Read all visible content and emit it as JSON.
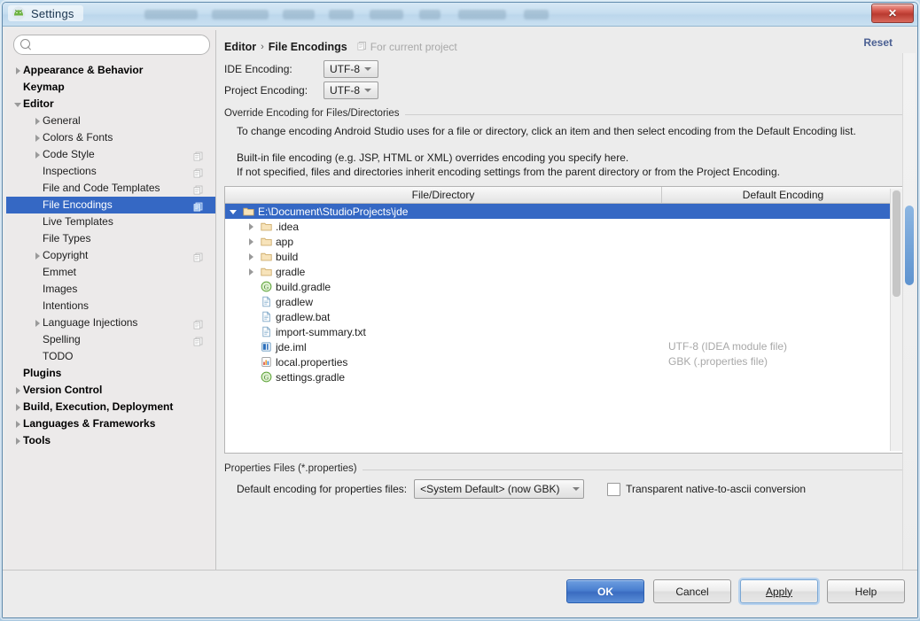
{
  "window": {
    "title": "Settings",
    "app_icon": "android-studio-icon",
    "close_label": "✕"
  },
  "sidebar": {
    "search": {
      "value": "",
      "placeholder": ""
    },
    "items": [
      {
        "label": "Appearance & Behavior",
        "level": 0,
        "bold": true,
        "arrow": "closed",
        "selected": false,
        "module_icon": false
      },
      {
        "label": "Keymap",
        "level": 0,
        "bold": true,
        "arrow": "none",
        "selected": false,
        "module_icon": false
      },
      {
        "label": "Editor",
        "level": 0,
        "bold": true,
        "arrow": "open",
        "selected": false,
        "module_icon": false
      },
      {
        "label": "General",
        "level": 1,
        "bold": false,
        "arrow": "closed",
        "selected": false,
        "module_icon": false
      },
      {
        "label": "Colors & Fonts",
        "level": 1,
        "bold": false,
        "arrow": "closed",
        "selected": false,
        "module_icon": false
      },
      {
        "label": "Code Style",
        "level": 1,
        "bold": false,
        "arrow": "closed",
        "selected": false,
        "module_icon": true
      },
      {
        "label": "Inspections",
        "level": 1,
        "bold": false,
        "arrow": "none",
        "selected": false,
        "module_icon": true
      },
      {
        "label": "File and Code Templates",
        "level": 1,
        "bold": false,
        "arrow": "none",
        "selected": false,
        "module_icon": true
      },
      {
        "label": "File Encodings",
        "level": 1,
        "bold": false,
        "arrow": "none",
        "selected": true,
        "module_icon": true
      },
      {
        "label": "Live Templates",
        "level": 1,
        "bold": false,
        "arrow": "none",
        "selected": false,
        "module_icon": false
      },
      {
        "label": "File Types",
        "level": 1,
        "bold": false,
        "arrow": "none",
        "selected": false,
        "module_icon": false
      },
      {
        "label": "Copyright",
        "level": 1,
        "bold": false,
        "arrow": "closed",
        "selected": false,
        "module_icon": true
      },
      {
        "label": "Emmet",
        "level": 1,
        "bold": false,
        "arrow": "none",
        "selected": false,
        "module_icon": false
      },
      {
        "label": "Images",
        "level": 1,
        "bold": false,
        "arrow": "none",
        "selected": false,
        "module_icon": false
      },
      {
        "label": "Intentions",
        "level": 1,
        "bold": false,
        "arrow": "none",
        "selected": false,
        "module_icon": false
      },
      {
        "label": "Language Injections",
        "level": 1,
        "bold": false,
        "arrow": "closed",
        "selected": false,
        "module_icon": true
      },
      {
        "label": "Spelling",
        "level": 1,
        "bold": false,
        "arrow": "none",
        "selected": false,
        "module_icon": true
      },
      {
        "label": "TODO",
        "level": 1,
        "bold": false,
        "arrow": "none",
        "selected": false,
        "module_icon": false
      },
      {
        "label": "Plugins",
        "level": 0,
        "bold": true,
        "arrow": "none",
        "selected": false,
        "module_icon": false
      },
      {
        "label": "Version Control",
        "level": 0,
        "bold": true,
        "arrow": "closed",
        "selected": false,
        "module_icon": false
      },
      {
        "label": "Build, Execution, Deployment",
        "level": 0,
        "bold": true,
        "arrow": "closed",
        "selected": false,
        "module_icon": false
      },
      {
        "label": "Languages & Frameworks",
        "level": 0,
        "bold": true,
        "arrow": "closed",
        "selected": false,
        "module_icon": false
      },
      {
        "label": "Tools",
        "level": 0,
        "bold": true,
        "arrow": "closed",
        "selected": false,
        "module_icon": false
      }
    ]
  },
  "main": {
    "breadcrumb": {
      "parent": "Editor",
      "separator": "›",
      "current": "File Encodings",
      "note": "For current project",
      "note_icon": "module-icon"
    },
    "reset_label": "Reset",
    "ide_encoding": {
      "label": "IDE Encoding:",
      "value": "UTF-8"
    },
    "project_encoding": {
      "label": "Project Encoding:",
      "value": "UTF-8"
    },
    "override_group": {
      "title": "Override Encoding for Files/Directories",
      "paragraph1": "To change encoding Android Studio uses for a file or directory, click an item and then select encoding from the Default Encoding list.",
      "paragraph2": "Built-in file encoding (e.g. JSP, HTML or XML) overrides encoding you specify here.",
      "paragraph3": "If not specified, files and directories inherit encoding settings from the parent directory or from the Project Encoding."
    },
    "table": {
      "columns": [
        "File/Directory",
        "Default Encoding"
      ],
      "rows": [
        {
          "name": "E:\\Document\\StudioProjects\\jde",
          "icon": "folder-icon",
          "indent": 0,
          "arrow": "open",
          "selected": true,
          "encoding": ""
        },
        {
          "name": ".idea",
          "icon": "folder-icon",
          "indent": 1,
          "arrow": "closed",
          "selected": false,
          "encoding": ""
        },
        {
          "name": "app",
          "icon": "folder-icon",
          "indent": 1,
          "arrow": "closed",
          "selected": false,
          "encoding": ""
        },
        {
          "name": "build",
          "icon": "folder-icon",
          "indent": 1,
          "arrow": "closed",
          "selected": false,
          "encoding": ""
        },
        {
          "name": "gradle",
          "icon": "folder-icon",
          "indent": 1,
          "arrow": "closed",
          "selected": false,
          "encoding": ""
        },
        {
          "name": "build.gradle",
          "icon": "gradle-icon",
          "indent": 1,
          "arrow": "none",
          "selected": false,
          "encoding": ""
        },
        {
          "name": "gradlew",
          "icon": "text-file-icon",
          "indent": 1,
          "arrow": "none",
          "selected": false,
          "encoding": ""
        },
        {
          "name": "gradlew.bat",
          "icon": "text-file-icon",
          "indent": 1,
          "arrow": "none",
          "selected": false,
          "encoding": ""
        },
        {
          "name": "import-summary.txt",
          "icon": "text-file-icon",
          "indent": 1,
          "arrow": "none",
          "selected": false,
          "encoding": ""
        },
        {
          "name": "jde.iml",
          "icon": "iml-file-icon",
          "indent": 1,
          "arrow": "none",
          "selected": false,
          "encoding": "UTF-8 (IDEA module file)"
        },
        {
          "name": "local.properties",
          "icon": "properties-icon",
          "indent": 1,
          "arrow": "none",
          "selected": false,
          "encoding": "GBK (.properties file)"
        },
        {
          "name": "settings.gradle",
          "icon": "gradle-icon",
          "indent": 1,
          "arrow": "none",
          "selected": false,
          "encoding": ""
        }
      ]
    },
    "properties_group": {
      "title": "Properties Files (*.properties)",
      "default_encoding_label": "Default encoding for properties files:",
      "default_encoding_value": "<System Default> (now GBK)",
      "transparent_label": "Transparent native-to-ascii conversion",
      "transparent_checked": false
    }
  },
  "footer": {
    "ok": "OK",
    "cancel": "Cancel",
    "apply": "Apply",
    "help": "Help"
  },
  "colors": {
    "selection_blue": "#3568c4",
    "link_blue": "#4a5f92",
    "panel_gray": "#ececec",
    "muted_text": "#a8a8a8"
  }
}
